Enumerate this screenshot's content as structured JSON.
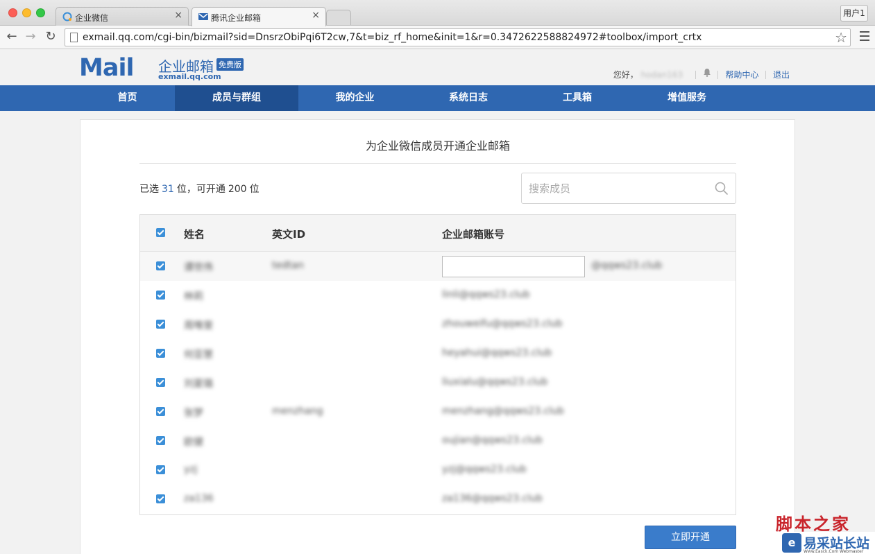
{
  "browser": {
    "tabs": [
      {
        "label": "企业微信",
        "icon": "wechat-work-icon",
        "active": false
      },
      {
        "label": "腾讯企业邮箱",
        "icon": "tencent-mail-icon",
        "active": true
      }
    ],
    "tab_close": "×",
    "user_button": "用户1",
    "url": "exmail.qq.com/cgi-bin/bizmail?sid=DnsrzObiPqi6T2cw,7&t=biz_rf_home&init=1&r=0.3472622588824972#toolbox/import_crtx"
  },
  "header": {
    "logo_mark": "Mail",
    "logo_title": "企业邮箱",
    "logo_badge": "免费版",
    "logo_domain": "exmail.qq.com",
    "greeting": "您好，",
    "username": "hodan163",
    "help_link": "帮助中心",
    "logout_link": "退出"
  },
  "nav": {
    "items": [
      {
        "label": "首页",
        "active": false
      },
      {
        "label": "成员与群组",
        "active": true
      },
      {
        "label": "我的企业",
        "active": false
      },
      {
        "label": "系统日志",
        "active": false
      },
      {
        "label": "工具箱",
        "active": false
      },
      {
        "label": "增值服务",
        "active": false
      }
    ]
  },
  "panel": {
    "title": "为企业微信成员开通企业邮箱",
    "selected_prefix": "已选",
    "selected_count": "31",
    "selected_mid": "位，可开通",
    "available_count": "200",
    "selected_suffix": "位",
    "search_placeholder": "搜索成员",
    "submit_label": "立即开通"
  },
  "table": {
    "columns": [
      "姓名",
      "英文ID",
      "企业邮箱账号"
    ],
    "rows": [
      {
        "name": "谭世伟",
        "english_id": "tedtan",
        "account": "",
        "domain": "@qqws23.club",
        "checked": true
      },
      {
        "name": "林莉",
        "english_id": "",
        "account": "linli@qqws23.club",
        "checked": true
      },
      {
        "name": "周唯斐",
        "english_id": "",
        "account": "zhouweifu@qqws23.club",
        "checked": true
      },
      {
        "name": "何亚慧",
        "english_id": "",
        "account": "heyahui@qqws23.club",
        "checked": true
      },
      {
        "name": "刘夏璐",
        "english_id": "",
        "account": "liuxialu@qqws23.club",
        "checked": true
      },
      {
        "name": "张梦",
        "english_id": "menzhang",
        "account": "menzhang@qqws23.club",
        "checked": true
      },
      {
        "name": "欧健",
        "english_id": "",
        "account": "oujian@qqws23.club",
        "checked": true
      },
      {
        "name": "yzj",
        "english_id": "",
        "account": "yzj@qqws23.club",
        "checked": true
      },
      {
        "name": "za136",
        "english_id": "",
        "account": "za136@qqws23.club",
        "checked": true
      }
    ]
  },
  "watermark": {
    "top": "脚本之家",
    "brand": "易采站长站",
    "sub": "Www.Easck.Com Webmaster"
  },
  "colors": {
    "brand_blue": "#2f67b1",
    "nav_active": "#1f4f90",
    "checkbox": "#3b8fd8",
    "watermark_red": "#c9252c"
  }
}
